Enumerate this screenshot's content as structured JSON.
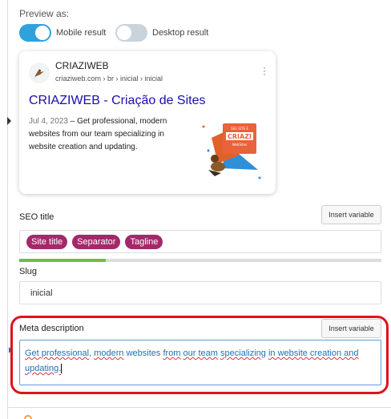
{
  "preview": {
    "label": "Preview as:",
    "mobile_label": "Mobile result",
    "mobile_on": true,
    "desktop_label": "Desktop result",
    "desktop_on": false
  },
  "serp": {
    "site_name": "CRIAZIWEB",
    "url": "criaziweb.com › br › inicial › inicial",
    "title": "CRIAZIWEB - Criação de Sites",
    "date": "Jul 4, 2023",
    "separator": " – ",
    "description": "Get professional, modern websites from our team specializing in website creation and updating.",
    "thumbnail_text_top": "SEU SITE É",
    "thumbnail_text_logo": "CRIAZI",
    "thumbnail_text_bottom": "WebSites",
    "site_icon": "bird-icon",
    "menu_icon": "more-vertical-icon"
  },
  "seo_title": {
    "label": "SEO title",
    "insert_label": "Insert variable",
    "pills": [
      "Site title",
      "Separator",
      "Tagline"
    ],
    "pill_color": "#a4286a",
    "progress_fraction": 0.24,
    "progress_color": "#6dbe45"
  },
  "slug": {
    "label": "Slug",
    "value": "inicial"
  },
  "meta": {
    "label": "Meta description",
    "insert_label": "Insert variable",
    "segments": [
      {
        "text": "Get ",
        "underline": true
      },
      {
        "text": "professional",
        "underline": true
      },
      {
        "text": ", ",
        "underline": false
      },
      {
        "text": "modern",
        "underline": true
      },
      {
        "text": " websites ",
        "underline": false
      },
      {
        "text": "from",
        "underline": true
      },
      {
        "text": " ",
        "underline": false
      },
      {
        "text": "our team",
        "underline": true
      },
      {
        "text": " ",
        "underline": false
      },
      {
        "text": "specializing",
        "underline": true
      },
      {
        "text": " ",
        "underline": false
      },
      {
        "text": "in website creation and",
        "underline": true
      },
      {
        "text": " ",
        "underline": false
      },
      {
        "text": "updating.",
        "underline": true
      }
    ],
    "highlight_color": "#e0121b"
  }
}
